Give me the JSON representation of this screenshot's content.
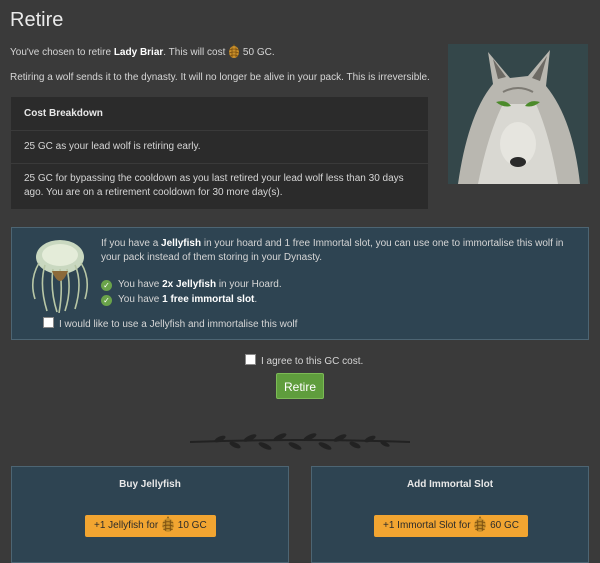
{
  "page": {
    "title": "Retire"
  },
  "intro": {
    "prefix": "You've chosen to retire ",
    "wolf_name": "Lady Briar",
    "middle": ". This will cost ",
    "cost": "50 GC.",
    "description": "Retiring a wolf sends it to the dynasty. It will no longer be alive in your pack. This is irreversible."
  },
  "breakdown": {
    "header": "Cost Breakdown",
    "rows": [
      "25 GC as your lead wolf is retiring early.",
      "25 GC for bypassing the cooldown as you last retired your lead wolf less than 30 days ago. You are on a retirement cooldown for 30 more day(s)."
    ]
  },
  "immortal": {
    "t1": "If you have a ",
    "t2": "Jellyfish",
    "t3": " in your hoard and 1 free Immortal slot, you can use one to immortalise this wolf in your pack instead of them storing in your Dynasty.",
    "c1_pre": "You have ",
    "c1_bold": "2x Jellyfish",
    "c1_post": " in your Hoard.",
    "c2_pre": "You have ",
    "c2_bold": "1 free immortal slot",
    "c2_post": ".",
    "option_label": "I would like to use a Jellyfish and immortalise this wolf"
  },
  "agree": {
    "label": "I agree to this GC cost."
  },
  "retire_button": "Retire",
  "shop": {
    "jellyfish": {
      "title": "Buy Jellyfish",
      "button_label": "+1 Jellyfish for",
      "button_price": "10 GC"
    },
    "immortal_slot": {
      "title": "Add Immortal Slot",
      "button_label": "+1 Immortal Slot for",
      "button_price": "60 GC"
    }
  },
  "icons": {
    "currency": "gc-pinecone-icon",
    "check": "check-circle-icon",
    "portrait": "wolf-portrait",
    "item": "jellyfish-icon",
    "divider": "branch-divider"
  },
  "colors": {
    "background": "#3a3a3a",
    "panel": "#2b2b2b",
    "info_panel": "#2e4452",
    "retire_button": "#5f9d3d",
    "shop_button": "#f2a531",
    "check": "#6aa34a"
  }
}
